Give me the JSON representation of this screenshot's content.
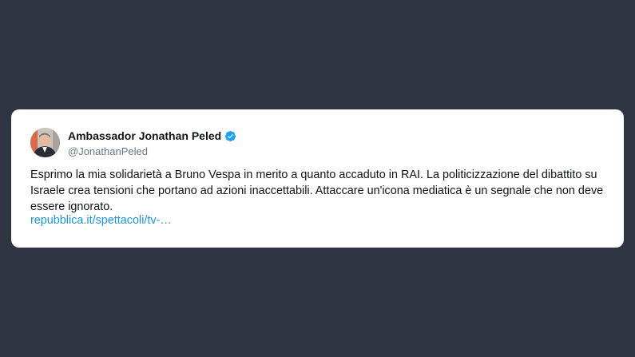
{
  "tweet": {
    "author_name": "Ambassador Jonathan Peled",
    "author_handle": "@JonathanPeled",
    "text": "Esprimo la mia solidarietà a Bruno Vespa in merito a quanto accaduto in RAI. La politicizzazione del dibattito su Israele crea tensioni che portano ad azioni inaccettabili. Attaccare un'icona mediatica è un segnale che non deve essere ignorato.",
    "link_text": "repubblica.it/spettacoli/tv-…"
  },
  "colors": {
    "background": "#2f3542",
    "card": "#ffffff",
    "text": "#0f1419",
    "handle": "#657786",
    "link": "#1b95e0",
    "verified": "#1da1f2"
  },
  "icons": {
    "verified": "verified-badge-icon",
    "avatar": "profile-photo"
  }
}
